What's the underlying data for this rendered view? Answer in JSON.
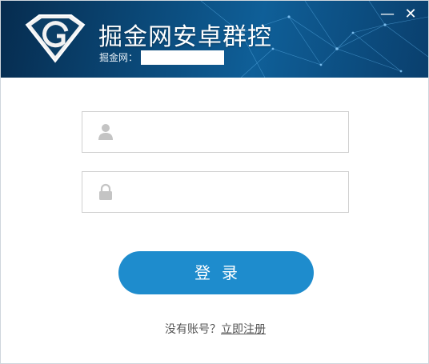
{
  "window": {
    "title": "掘金网安卓群控",
    "minimize_glyph": "—",
    "close_glyph": "✕"
  },
  "account": {
    "label": "掘金网：",
    "value": ""
  },
  "login": {
    "username_icon": "user-icon",
    "username_value": "",
    "password_icon": "lock-icon",
    "password_value": "",
    "submit_label": "登录"
  },
  "register": {
    "prompt": "没有账号？",
    "link": "立即注册"
  },
  "colors": {
    "header_dark": "#062c4f",
    "header_light": "#0f5f98",
    "accent": "#1e8ccd",
    "input_border": "#d0d0d0",
    "icon_gray": "#c4c4c4"
  }
}
